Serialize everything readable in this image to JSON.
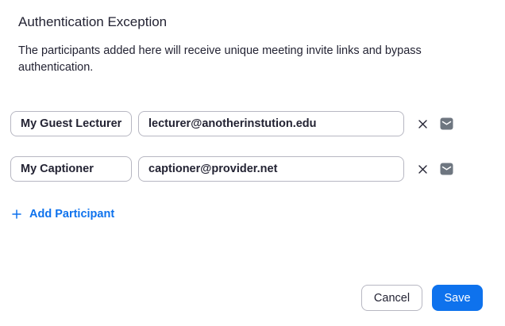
{
  "dialog": {
    "title": "Authentication Exception",
    "description": "The participants added here will receive unique meeting invite links and bypass authentication."
  },
  "participants": [
    {
      "name": "My Guest Lecturer",
      "email": "lecturer@anotherinstution.edu"
    },
    {
      "name": "My Captioner",
      "email": "captioner@provider.net"
    }
  ],
  "icons": {
    "remove": "close-icon",
    "mail": "envelope-icon",
    "add": "plus-icon"
  },
  "actions": {
    "add_participant_label": "Add Participant",
    "cancel_label": "Cancel",
    "save_label": "Save"
  },
  "colors": {
    "accent": "#0e72ed",
    "text": "#232333",
    "border": "#b7b7c2",
    "icon": "#6e7680"
  }
}
